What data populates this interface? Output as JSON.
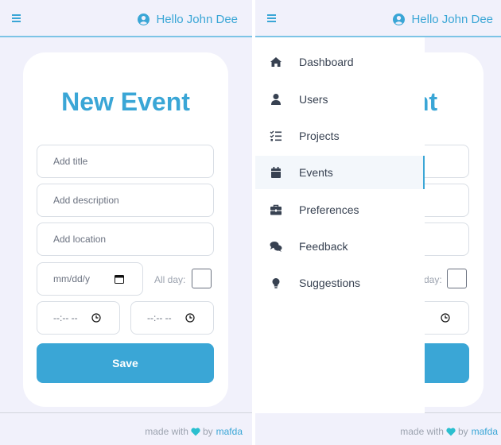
{
  "header": {
    "greeting": "Hello John Dee"
  },
  "form": {
    "title": "New Event",
    "title_placeholder": "Add title",
    "description_placeholder": "Add description",
    "location_placeholder": "Add location",
    "date_placeholder": "mm/dd/y",
    "allday_label": "All day:",
    "time_placeholder": "--:-- --",
    "save_label": "Save",
    "right_title_fragment": "nt",
    "right_allday_fragment": "day:"
  },
  "footer": {
    "made_with": "made with",
    "by": "by",
    "author": "mafda"
  },
  "nav": {
    "items": [
      {
        "label": "Dashboard",
        "icon": "home-icon"
      },
      {
        "label": "Users",
        "icon": "user-icon"
      },
      {
        "label": "Projects",
        "icon": "checklist-icon"
      },
      {
        "label": "Events",
        "icon": "calendar-icon",
        "active": true
      },
      {
        "label": "Preferences",
        "icon": "toolbox-icon"
      },
      {
        "label": "Feedback",
        "icon": "comments-icon"
      },
      {
        "label": "Suggestions",
        "icon": "lightbulb-icon"
      }
    ]
  },
  "colors": {
    "accent": "#3aa6d6",
    "heart": "#2bbfcf",
    "background": "#f1f1fb"
  }
}
